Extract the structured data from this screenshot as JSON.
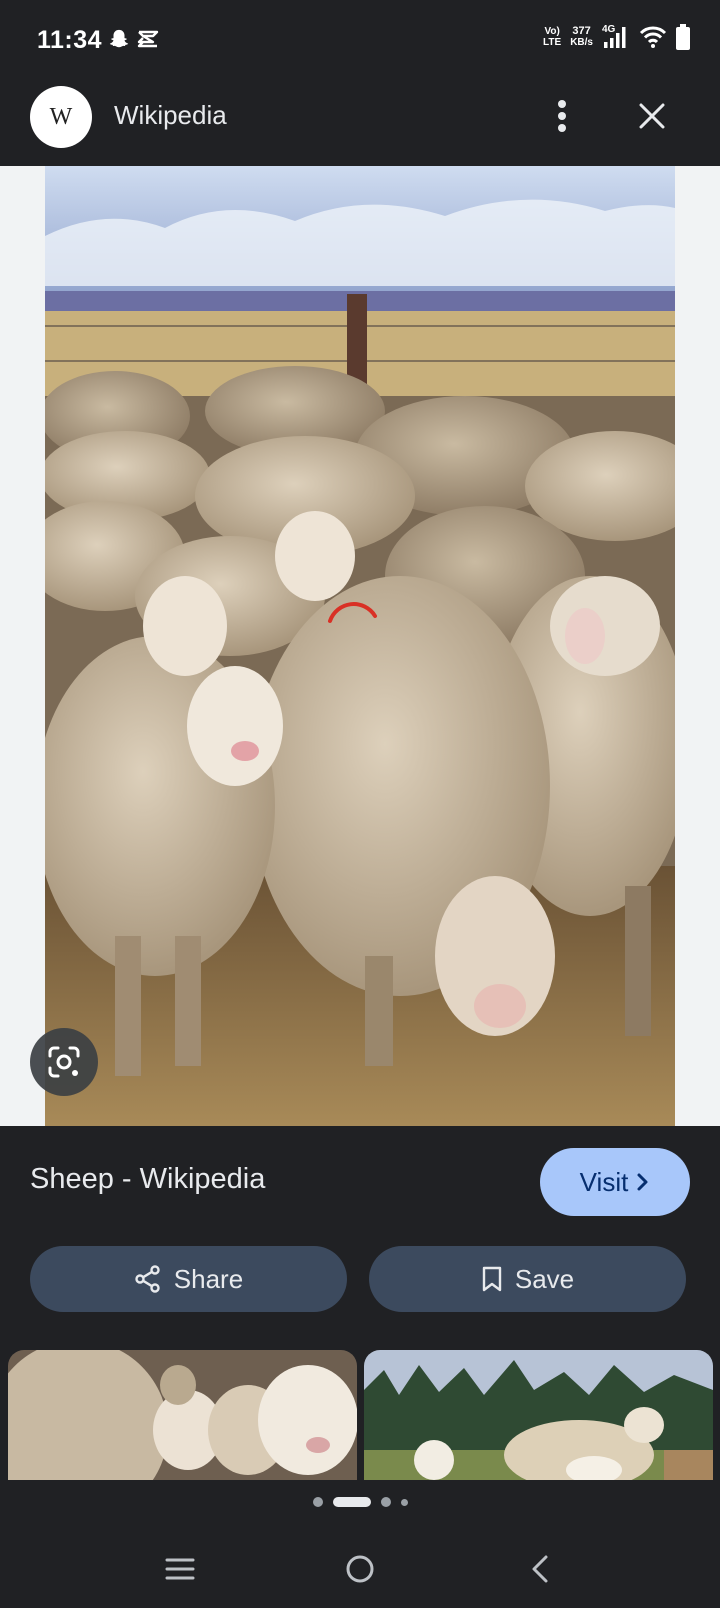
{
  "status": {
    "time": "11:34",
    "volte_line1": "Vo)",
    "volte_line2": "LTE",
    "speed_value": "377",
    "speed_unit": "KB/s",
    "network": "4G"
  },
  "header": {
    "avatar_letter": "W",
    "title": "Wikipedia"
  },
  "result": {
    "title": "Sheep - Wikipedia",
    "visit_label": "Visit"
  },
  "actions": {
    "share_label": "Share",
    "save_label": "Save"
  },
  "pager": {
    "active_index": 1
  },
  "colors": {
    "background": "#202124",
    "visit_button": "#a8c7fa",
    "action_button": "#3c4a5e",
    "loading_spinner": "#d93025"
  },
  "icons": [
    "snapchat-icon",
    "capcut-icon",
    "signal-icon",
    "wifi-icon",
    "battery-icon",
    "more-vert-icon",
    "close-icon",
    "google-lens-icon",
    "chevron-right-icon",
    "share-icon",
    "bookmark-icon",
    "recents-icon",
    "home-icon",
    "back-icon"
  ]
}
